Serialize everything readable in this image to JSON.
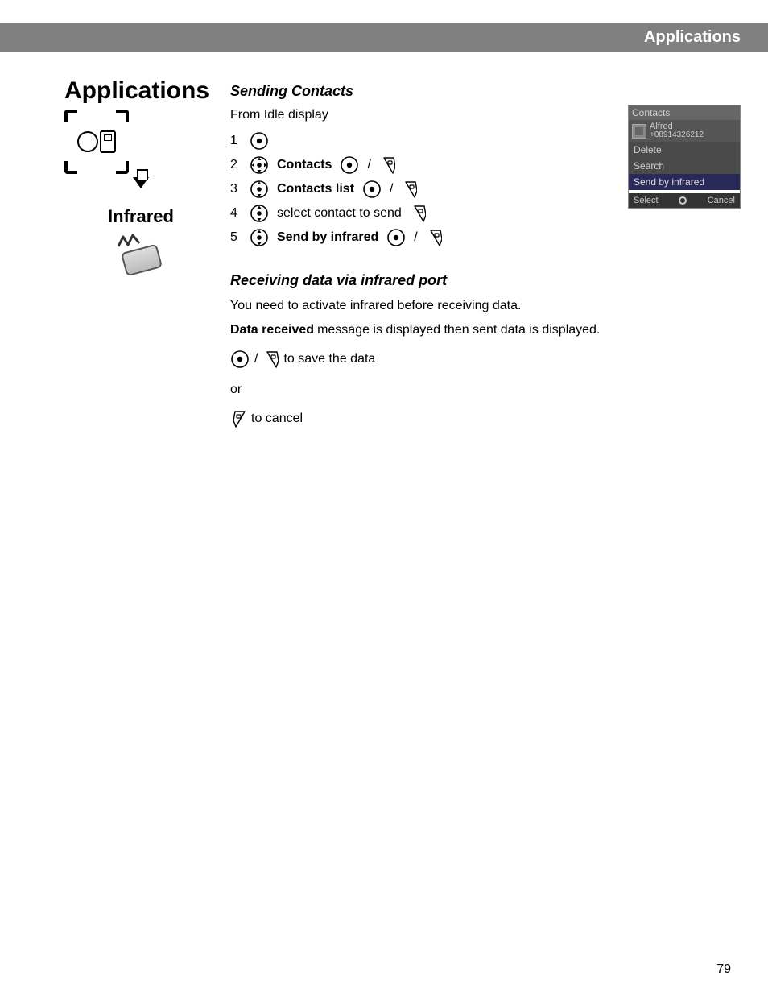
{
  "header": {
    "title": "Applications"
  },
  "left": {
    "title": "Applications",
    "infrared_label": "Infrared"
  },
  "main": {
    "sending_title": "Sending Contacts",
    "from_idle": "From Idle display",
    "steps": {
      "s1": "1",
      "s2": "2",
      "s2_label": "Contacts",
      "s3": "3",
      "s3_label": "Contacts list",
      "s4": "4",
      "s4_label": "select contact to send",
      "s5": "5",
      "s5_label": "Send by infrared"
    },
    "slash": "/",
    "receiving_title": "Receiving data via infrared port",
    "receiving_line1": "You need to activate infrared before receiving data.",
    "receiving_line2_bold": "Data received",
    "receiving_line2_rest": " message is displayed then sent data is displayed.",
    "save_text": " to save the data",
    "or_text": "or",
    "cancel_text": " to cancel"
  },
  "phone": {
    "title": "Contacts",
    "contact_name": "Alfred",
    "contact_number": "+08914326212",
    "menu": {
      "delete": "Delete",
      "search": "Search",
      "send": "Send by infrared"
    },
    "softkeys": {
      "left": "Select",
      "right": "Cancel"
    }
  },
  "page_number": "79"
}
